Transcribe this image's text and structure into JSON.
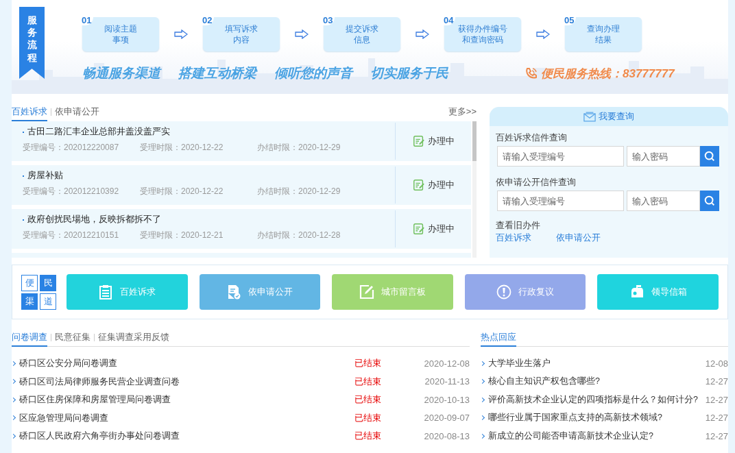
{
  "banner": {
    "ribbon": "服务流程",
    "steps": [
      {
        "number": "01",
        "lines": [
          "阅读主题",
          "事项"
        ]
      },
      {
        "number": "02",
        "lines": [
          "填写诉求",
          "内容"
        ]
      },
      {
        "number": "03",
        "lines": [
          "提交诉求",
          "信息"
        ]
      },
      {
        "number": "04",
        "lines": [
          "获得办件编号",
          "和查询密码"
        ]
      },
      {
        "number": "05",
        "lines": [
          "查询办理",
          "结果"
        ]
      }
    ],
    "slogans": [
      "畅通服务渠道",
      "搭建互动桥梁",
      "倾听您的声音",
      "切实服务于民"
    ],
    "hotline": "便民服务热线：83777777"
  },
  "requests": {
    "tabs": [
      {
        "label": "百姓诉求",
        "selected": true
      },
      {
        "label": "依申请公开",
        "selected": false
      }
    ],
    "more": "更多>>",
    "items": [
      {
        "title": "古田二路汇丰企业总部井盖没盖严实",
        "number": "受理编号：202012220087",
        "accepted": "受理时限：2020-12-22",
        "deadline": "办结时限：2020-12-29",
        "status": "办理中"
      },
      {
        "title": "房屋补贴",
        "number": "受理编号：202012210392",
        "accepted": "受理时限：2020-12-22",
        "deadline": "办结时限：2020-12-29",
        "status": "办理中"
      },
      {
        "title": "政府创扰民場地，反映拆都拆不了",
        "number": "受理编号：202012210151",
        "accepted": "受理时限：2020-12-21",
        "deadline": "办结时限：2020-12-28",
        "status": "办理中"
      }
    ]
  },
  "query": {
    "title": "我要查询",
    "sections": [
      {
        "label": "百姓诉求信件查询",
        "number_placeholder": "请输入受理编号",
        "password_placeholder": "输入密码"
      },
      {
        "label": "依申请公开信件查询",
        "number_placeholder": "请输入受理编号",
        "password_placeholder": "输入密码"
      }
    ],
    "old_label": "查看旧办件",
    "old_links": [
      "百姓诉求",
      "依申请公开"
    ]
  },
  "channels": {
    "badge": [
      {
        "char": "便",
        "filled": false
      },
      {
        "char": "民",
        "filled": true
      },
      {
        "char": "渠",
        "filled": true
      },
      {
        "char": "道",
        "filled": false
      }
    ],
    "buttons": [
      {
        "label": "百姓诉求",
        "kind": "clipboard",
        "color": "#22d3dc"
      },
      {
        "label": "依申请公开",
        "kind": "document",
        "color": "#62b6e4"
      },
      {
        "label": "城市留言板",
        "kind": "edit",
        "color": "#a0d873"
      },
      {
        "label": "行政复议",
        "kind": "alert",
        "color": "#93a8ea"
      },
      {
        "label": "领导信箱",
        "kind": "mailbox",
        "color": "#1fd4de"
      }
    ]
  },
  "surveys": {
    "tabs": [
      {
        "label": "问卷调查",
        "selected": true
      },
      {
        "label": "民意征集",
        "selected": false
      },
      {
        "label": "征集调查采用反馈",
        "selected": false
      }
    ],
    "rows": [
      {
        "title": "硚口区公安分局问卷调查",
        "status": "已结束",
        "date": "2020-12-08"
      },
      {
        "title": "硚口区司法局律师服务民营企业调查问卷",
        "status": "已结束",
        "date": "2020-11-13"
      },
      {
        "title": "硚口区住房保障和房屋管理局问卷调查",
        "status": "已结束",
        "date": "2020-10-13"
      },
      {
        "title": "区应急管理局问卷调查",
        "status": "已结束",
        "date": "2020-09-07"
      },
      {
        "title": "硚口区人民政府六角亭街办事处问卷调查",
        "status": "已结束",
        "date": "2020-08-13"
      }
    ]
  },
  "hot": {
    "tabs": [
      {
        "label": "热点回应",
        "selected": true
      }
    ],
    "rows": [
      {
        "title": "大学毕业生落户",
        "date": "12-08"
      },
      {
        "title": "核心自主知识产权包含哪些?",
        "date": "12-27"
      },
      {
        "title": "评价高新技术企业认定的四项指标是什么？如何计分?",
        "date": "12-27"
      },
      {
        "title": "哪些行业属于国家重点支持的高新技术领域?",
        "date": "12-27"
      },
      {
        "title": "新成立的公司能否申请高新技术企业认定?",
        "date": "12-27"
      }
    ]
  }
}
